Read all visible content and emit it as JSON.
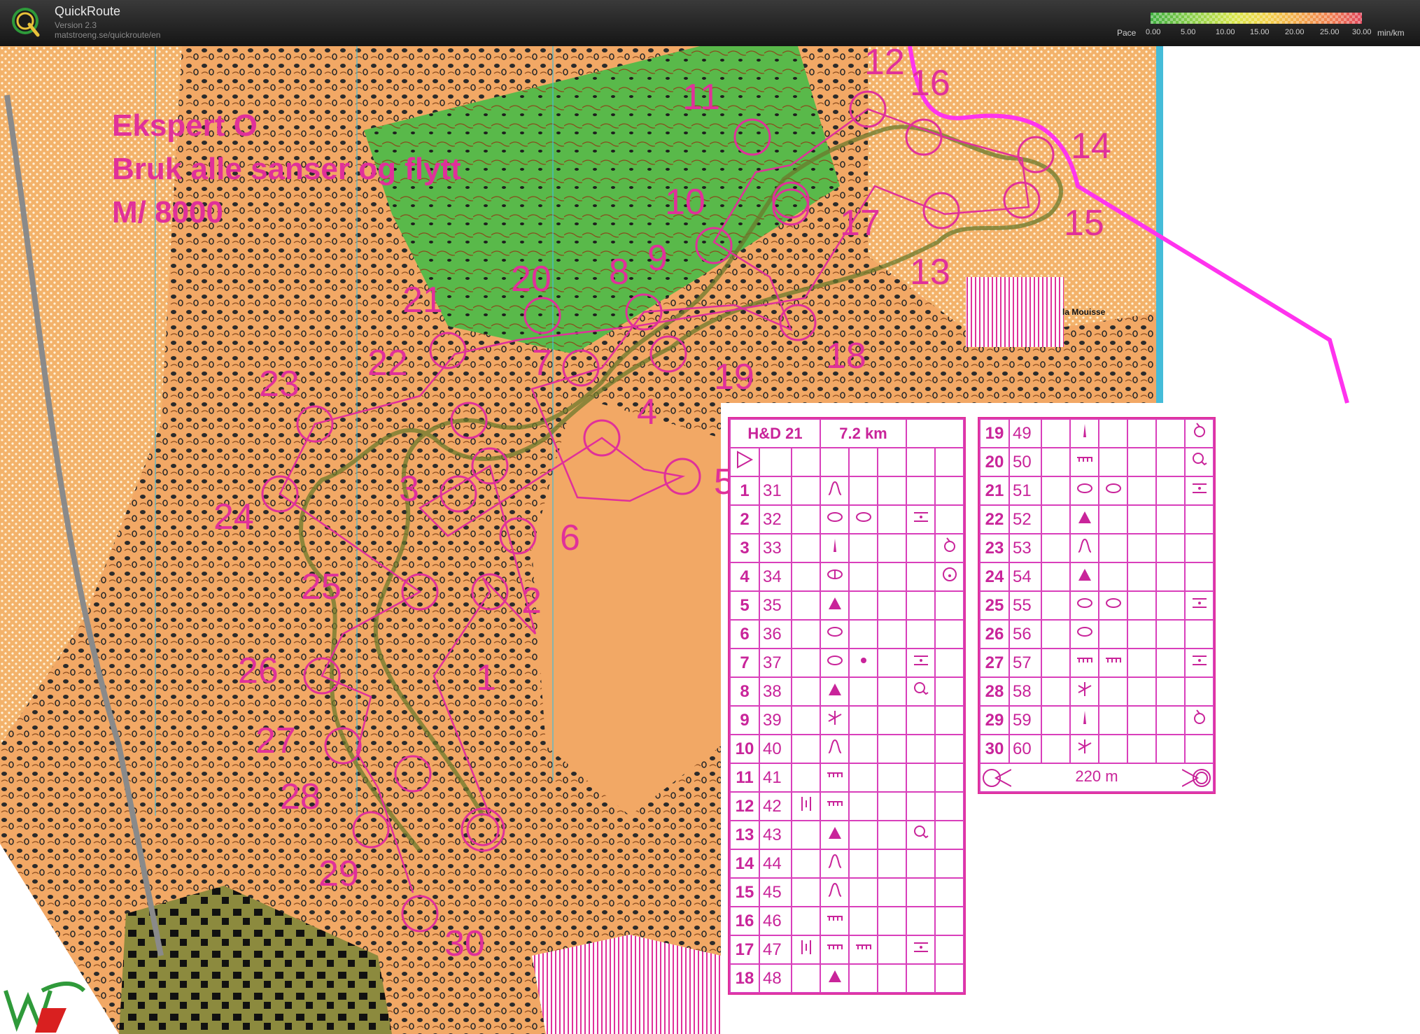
{
  "app": {
    "title": "QuickRoute",
    "version": "Version 2.3",
    "url": "matstroeng.se/quickroute/en"
  },
  "pace": {
    "label": "Pace",
    "ticks": [
      "0.00",
      "5.00",
      "10.00",
      "15.00",
      "20.00",
      "25.00",
      "30.00"
    ],
    "unit": "min/km"
  },
  "map": {
    "title_lines": [
      "Ekspert O",
      "Bruk alle sanser og flytt",
      "M/ 8000"
    ],
    "place_label": "la Mouisse",
    "colors": {
      "overprint": "#e0309a",
      "route": "#ff33ee",
      "water": "#44bcd8"
    }
  },
  "controls": [
    {
      "n": "1"
    },
    {
      "n": "2"
    },
    {
      "n": "3"
    },
    {
      "n": "4"
    },
    {
      "n": "5"
    },
    {
      "n": "6"
    },
    {
      "n": "7"
    },
    {
      "n": "8"
    },
    {
      "n": "9"
    },
    {
      "n": "10"
    },
    {
      "n": "11"
    },
    {
      "n": "12"
    },
    {
      "n": "13"
    },
    {
      "n": "14"
    },
    {
      "n": "15"
    },
    {
      "n": "16"
    },
    {
      "n": "17"
    },
    {
      "n": "18"
    },
    {
      "n": "19"
    },
    {
      "n": "20"
    },
    {
      "n": "21"
    },
    {
      "n": "22"
    },
    {
      "n": "23"
    },
    {
      "n": "24"
    },
    {
      "n": "25"
    },
    {
      "n": "26"
    },
    {
      "n": "27"
    },
    {
      "n": "28"
    },
    {
      "n": "29"
    },
    {
      "n": "30"
    }
  ],
  "description_sheet": {
    "class": "H&D 21",
    "length": "7.2 km",
    "finish_distance": "220 m",
    "rows": [
      {
        "num": "1",
        "code": "31",
        "sym": [
          "",
          "knoll",
          "",
          "",
          "",
          ""
        ]
      },
      {
        "num": "2",
        "code": "32",
        "sym": [
          "",
          "ellipse",
          "ellipse",
          "",
          "between",
          ""
        ]
      },
      {
        "num": "3",
        "code": "33",
        "sym": [
          "",
          "pillar",
          "",
          "",
          "",
          "circle-tick"
        ]
      },
      {
        "num": "4",
        "code": "34",
        "sym": [
          "",
          "ellipse-line",
          "",
          "",
          "",
          "circle-dot"
        ]
      },
      {
        "num": "5",
        "code": "35",
        "sym": [
          "",
          "triangle",
          "",
          "",
          "",
          ""
        ]
      },
      {
        "num": "6",
        "code": "36",
        "sym": [
          "",
          "ellipse",
          "",
          "",
          "",
          ""
        ]
      },
      {
        "num": "7",
        "code": "37",
        "sym": [
          "",
          "ellipse",
          "dot",
          "",
          "between",
          ""
        ]
      },
      {
        "num": "8",
        "code": "38",
        "sym": [
          "",
          "triangle",
          "",
          "",
          "circle-side",
          ""
        ]
      },
      {
        "num": "9",
        "code": "39",
        "sym": [
          "",
          "junction",
          "",
          "",
          "",
          ""
        ]
      },
      {
        "num": "10",
        "code": "40",
        "sym": [
          "",
          "knoll",
          "",
          "",
          "",
          ""
        ]
      },
      {
        "num": "11",
        "code": "41",
        "sym": [
          "",
          "wall",
          "",
          "",
          "",
          ""
        ]
      },
      {
        "num": "12",
        "code": "42",
        "sym": [
          "double-bar",
          "wall",
          "",
          "",
          "",
          ""
        ]
      },
      {
        "num": "13",
        "code": "43",
        "sym": [
          "",
          "triangle",
          "",
          "",
          "circle-side",
          ""
        ]
      },
      {
        "num": "14",
        "code": "44",
        "sym": [
          "",
          "knoll",
          "",
          "",
          "",
          ""
        ]
      },
      {
        "num": "15",
        "code": "45",
        "sym": [
          "",
          "knoll",
          "",
          "",
          "",
          ""
        ]
      },
      {
        "num": "16",
        "code": "46",
        "sym": [
          "",
          "wall",
          "",
          "",
          "",
          ""
        ]
      },
      {
        "num": "17",
        "code": "47",
        "sym": [
          "double-bar",
          "wall",
          "wall",
          "",
          "between",
          ""
        ]
      },
      {
        "num": "18",
        "code": "48",
        "sym": [
          "",
          "triangle",
          "",
          "",
          "",
          ""
        ]
      },
      {
        "num": "19",
        "code": "49",
        "sym": [
          "",
          "pillar",
          "",
          "",
          "",
          "circle-tick"
        ]
      },
      {
        "num": "20",
        "code": "50",
        "sym": [
          "",
          "wall",
          "",
          "",
          "",
          "circle-side"
        ]
      },
      {
        "num": "21",
        "code": "51",
        "sym": [
          "",
          "ellipse",
          "ellipse",
          "",
          "",
          "between"
        ]
      },
      {
        "num": "22",
        "code": "52",
        "sym": [
          "",
          "triangle",
          "",
          "",
          "",
          ""
        ]
      },
      {
        "num": "23",
        "code": "53",
        "sym": [
          "",
          "knoll",
          "",
          "",
          "",
          ""
        ]
      },
      {
        "num": "24",
        "code": "54",
        "sym": [
          "",
          "triangle",
          "",
          "",
          "",
          ""
        ]
      },
      {
        "num": "25",
        "code": "55",
        "sym": [
          "",
          "ellipse",
          "ellipse",
          "",
          "",
          "between"
        ]
      },
      {
        "num": "26",
        "code": "56",
        "sym": [
          "",
          "ellipse",
          "",
          "",
          "",
          ""
        ]
      },
      {
        "num": "27",
        "code": "57",
        "sym": [
          "",
          "wall",
          "wall",
          "",
          "",
          "between"
        ]
      },
      {
        "num": "28",
        "code": "58",
        "sym": [
          "",
          "junction",
          "",
          "",
          "",
          ""
        ]
      },
      {
        "num": "29",
        "code": "59",
        "sym": [
          "",
          "pillar",
          "",
          "",
          "",
          "circle-tick"
        ]
      },
      {
        "num": "30",
        "code": "60",
        "sym": [
          "",
          "junction",
          "",
          "",
          "",
          ""
        ]
      }
    ]
  }
}
